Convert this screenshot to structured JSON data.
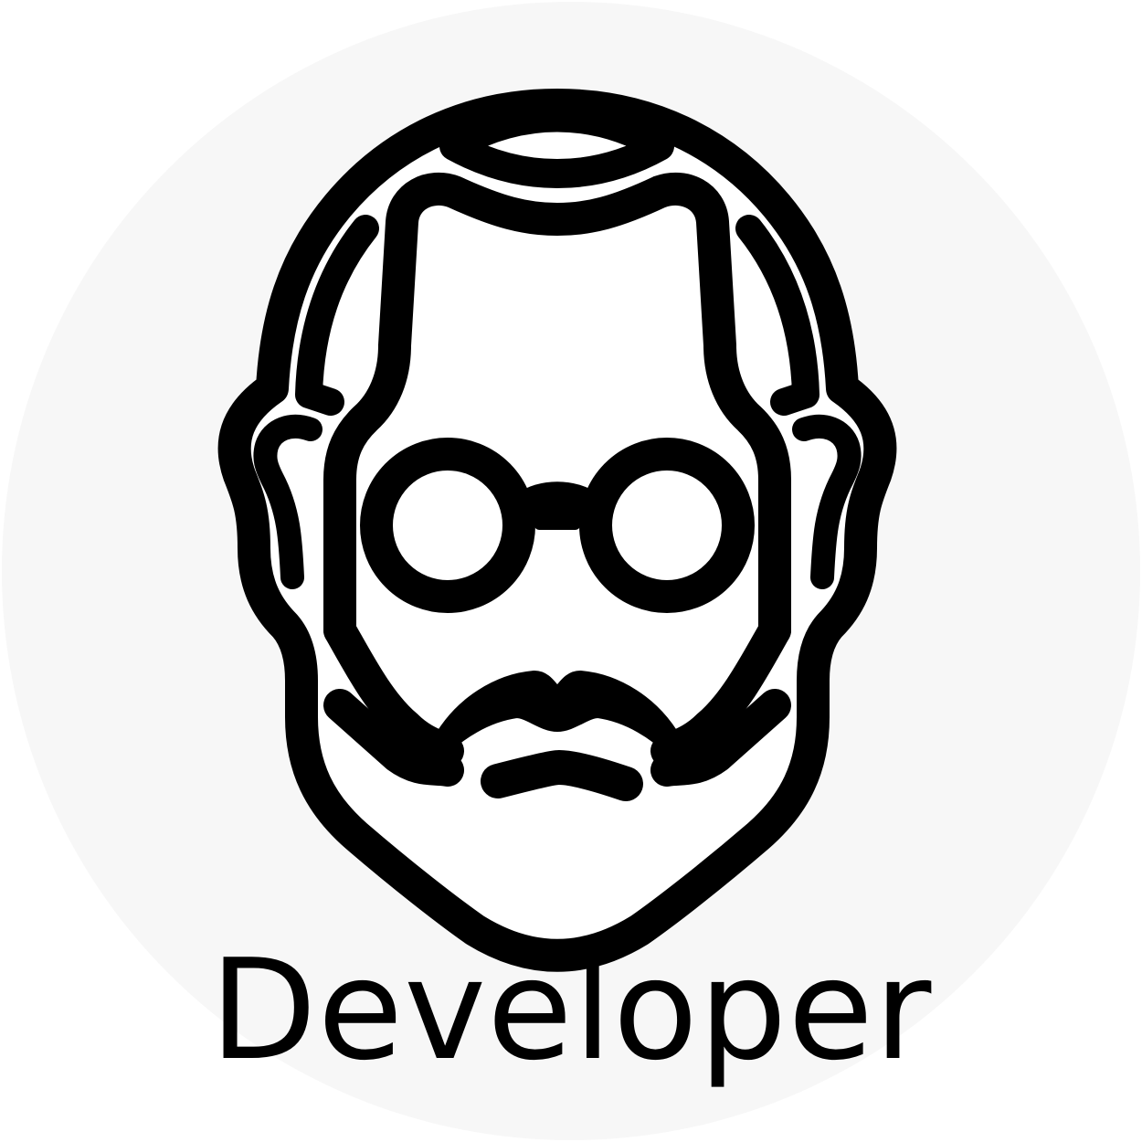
{
  "badge": {
    "label": "Developer",
    "icon": "developer-avatar-icon",
    "colors": {
      "background": "#f7f7f7",
      "stroke": "#000000",
      "fill": "#ffffff",
      "text": "#000000"
    }
  }
}
